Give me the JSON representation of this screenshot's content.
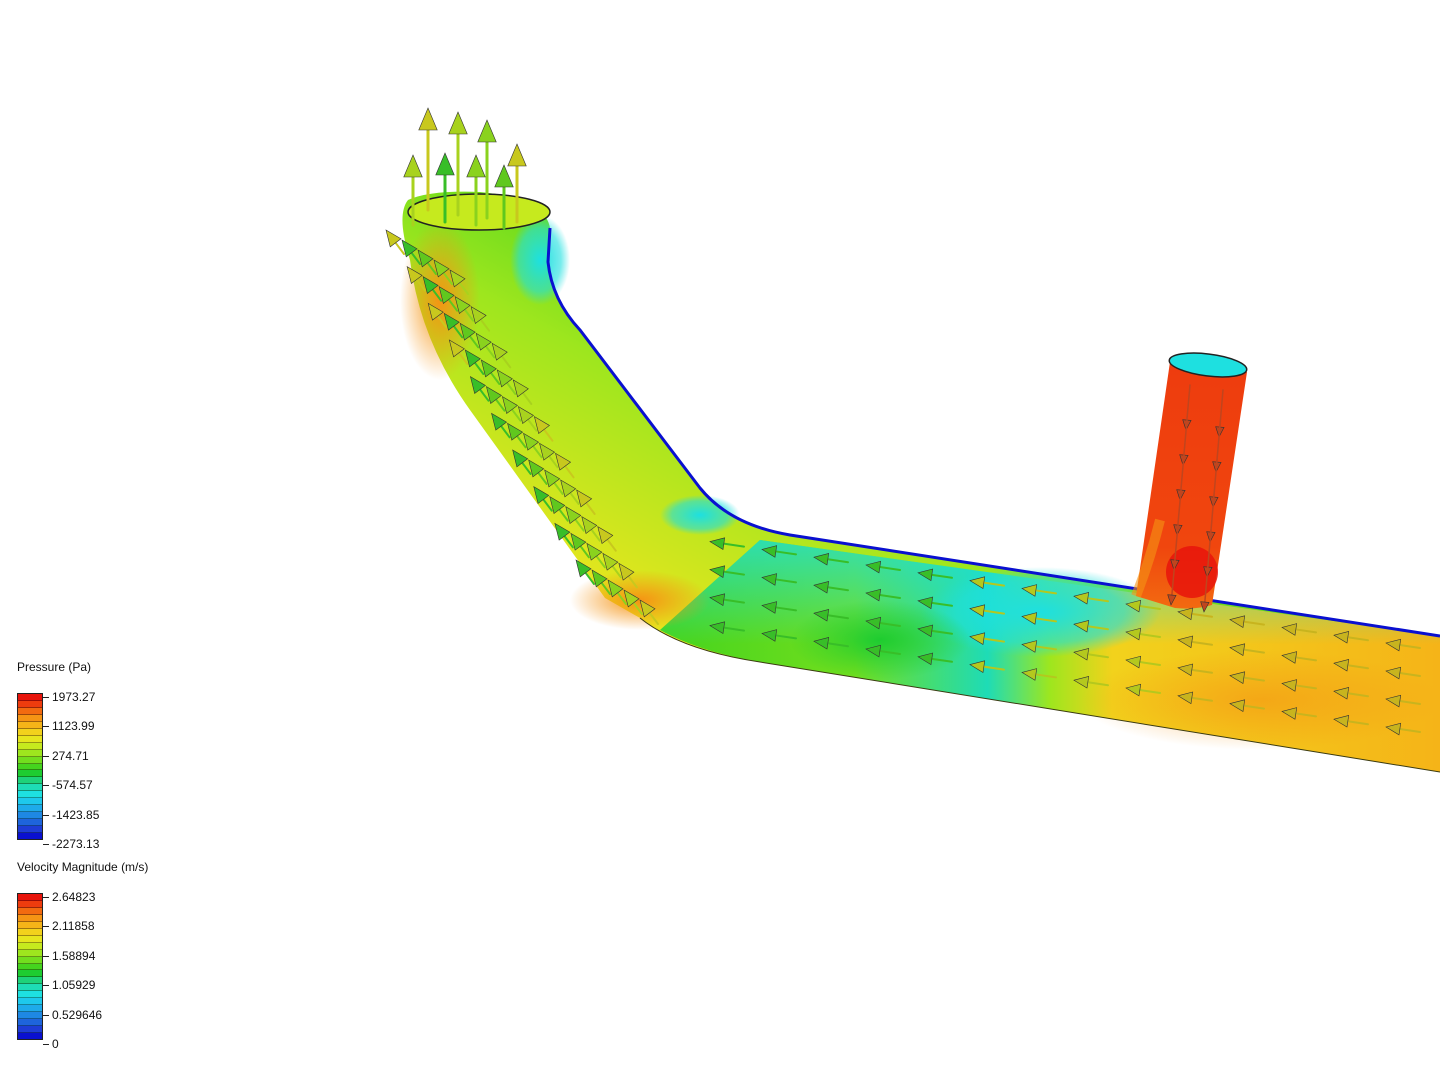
{
  "legends": [
    {
      "title": "Pressure (Pa)",
      "labels": [
        "1973.27",
        "1123.99",
        "274.71",
        "-574.57",
        "-1423.85",
        "-2273.13"
      ]
    },
    {
      "title": "Velocity Magnitude (m/s)",
      "labels": [
        "2.64823",
        "2.11858",
        "1.58894",
        "1.05929",
        "0.529646",
        "0"
      ]
    }
  ],
  "colormap": [
    "#e8140c",
    "#ee3c0e",
    "#f26a10",
    "#f59414",
    "#f5b418",
    "#f2d21c",
    "#e6e61e",
    "#c6ea1e",
    "#9ee61e",
    "#72de1e",
    "#44d41e",
    "#1ecc30",
    "#1ed27a",
    "#1edcb6",
    "#1ee0e0",
    "#1ec8ec",
    "#1eaaea",
    "#1e88e4",
    "#1e64dc",
    "#1e3cd6",
    "#0a10d0"
  ]
}
